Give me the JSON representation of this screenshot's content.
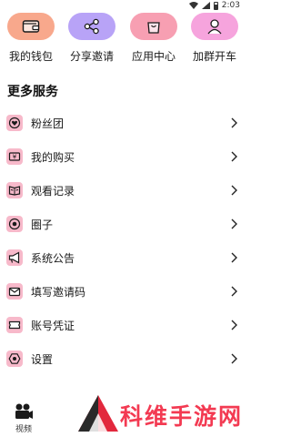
{
  "status_bar": {
    "time": "2:03"
  },
  "quick_actions": [
    {
      "label": "我的钱包",
      "icon": "wallet-icon",
      "color": "#f8a88c"
    },
    {
      "label": "分享邀请",
      "icon": "share-icon",
      "color": "#b8a3f7"
    },
    {
      "label": "应用中心",
      "icon": "shopping-bag-icon",
      "color": "#f79fb2"
    },
    {
      "label": "加群开车",
      "icon": "group-icon",
      "color": "#f6a4dd"
    }
  ],
  "more_services": {
    "title": "更多服务",
    "items": [
      {
        "label": "粉丝团",
        "icon": "heart-icon"
      },
      {
        "label": "我的购买",
        "icon": "purchase-icon"
      },
      {
        "label": "观看记录",
        "icon": "history-icon"
      },
      {
        "label": "圈子",
        "icon": "circle-icon"
      },
      {
        "label": "系统公告",
        "icon": "megaphone-icon"
      },
      {
        "label": "填写邀请码",
        "icon": "envelope-icon"
      },
      {
        "label": "账号凭证",
        "icon": "ticket-icon"
      },
      {
        "label": "设置",
        "icon": "settings-icon"
      }
    ]
  },
  "bottom_nav": {
    "video_label": "视频"
  },
  "watermark": {
    "text": "科维手游网"
  },
  "colors": {
    "accent": "#f7b9ca",
    "watermark": "#f33a52"
  }
}
